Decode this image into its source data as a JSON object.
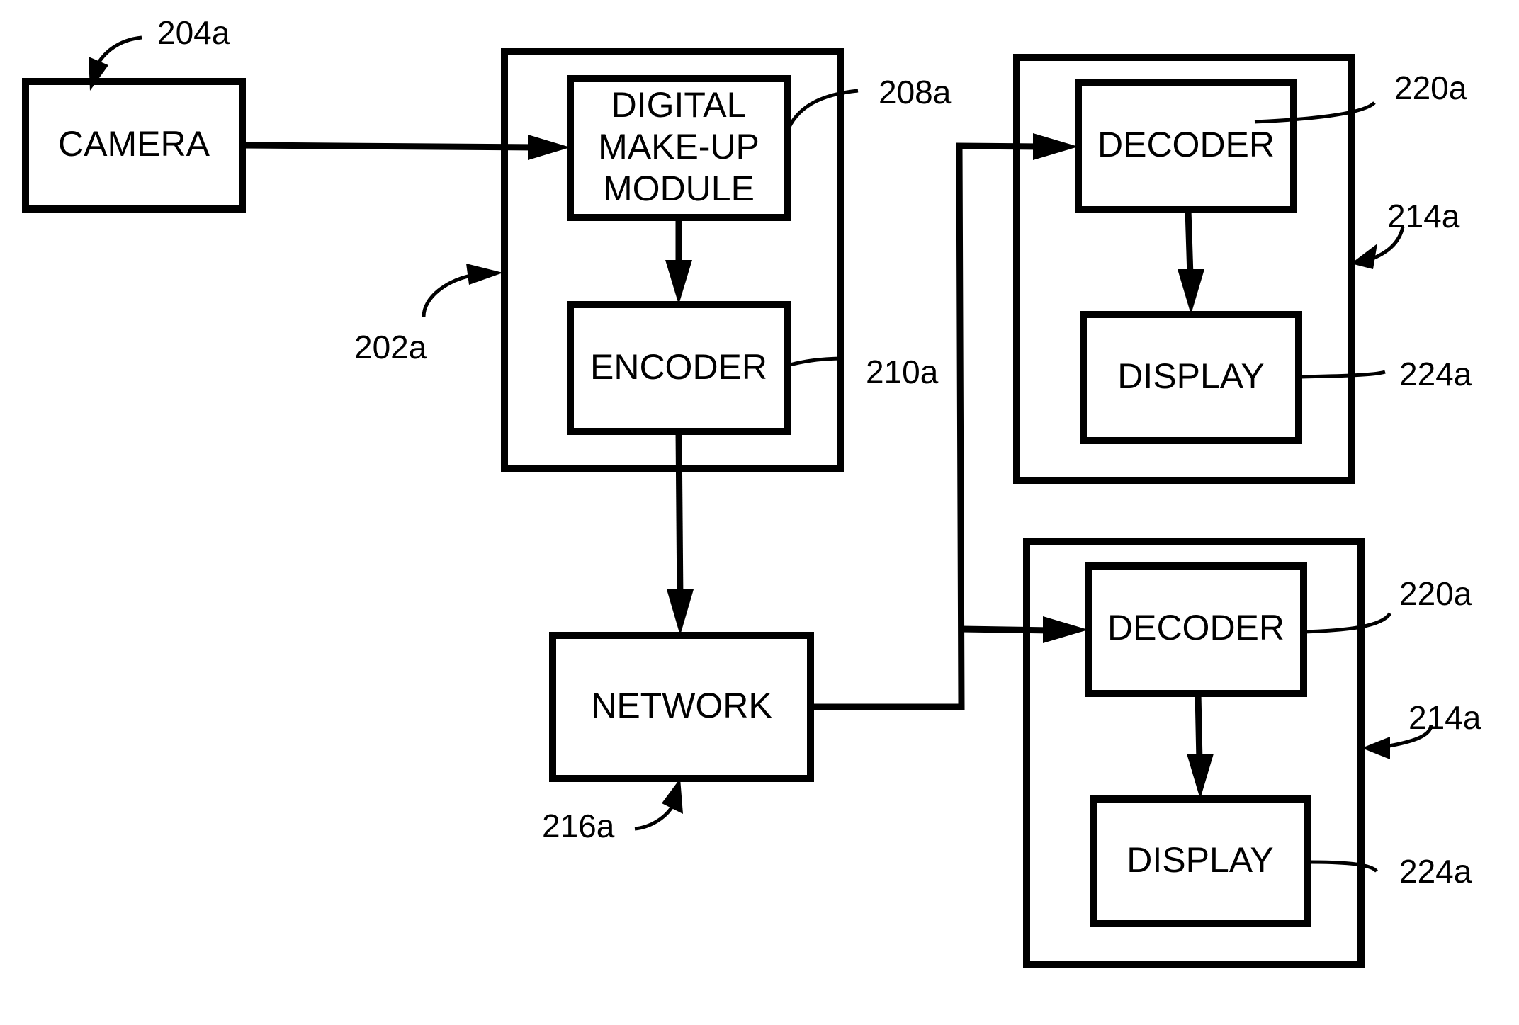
{
  "diagram": {
    "type": "block-diagram",
    "colors": {
      "stroke": "#000000",
      "background": "#ffffff"
    },
    "blocks": {
      "camera": {
        "label": "CAMERA",
        "ref": "204a"
      },
      "sender_device": {
        "ref": "202a"
      },
      "makeup_module": {
        "lines": [
          "DIGITAL",
          "MAKE-UP",
          "MODULE"
        ],
        "ref": "208a"
      },
      "encoder": {
        "label": "ENCODER",
        "ref": "210a"
      },
      "network": {
        "label": "NETWORK",
        "ref": "216a"
      },
      "receiver_1": {
        "ref": "214a",
        "decoder": {
          "label": "DECODER",
          "ref": "220a"
        },
        "display": {
          "label": "DISPLAY",
          "ref": "224a"
        }
      },
      "receiver_2": {
        "ref": "214a",
        "decoder": {
          "label": "DECODER",
          "ref": "220a"
        },
        "display": {
          "label": "DISPLAY",
          "ref": "224a"
        }
      }
    },
    "connections": [
      {
        "from": "CAMERA",
        "to": "DIGITAL MAKE-UP MODULE"
      },
      {
        "from": "DIGITAL MAKE-UP MODULE",
        "to": "ENCODER"
      },
      {
        "from": "ENCODER",
        "to": "NETWORK"
      },
      {
        "from": "NETWORK",
        "to": "DECODER (receiver 1)"
      },
      {
        "from": "NETWORK",
        "to": "DECODER (receiver 2)"
      },
      {
        "from": "DECODER (receiver 1)",
        "to": "DISPLAY (receiver 1)"
      },
      {
        "from": "DECODER (receiver 2)",
        "to": "DISPLAY (receiver 2)"
      }
    ]
  }
}
